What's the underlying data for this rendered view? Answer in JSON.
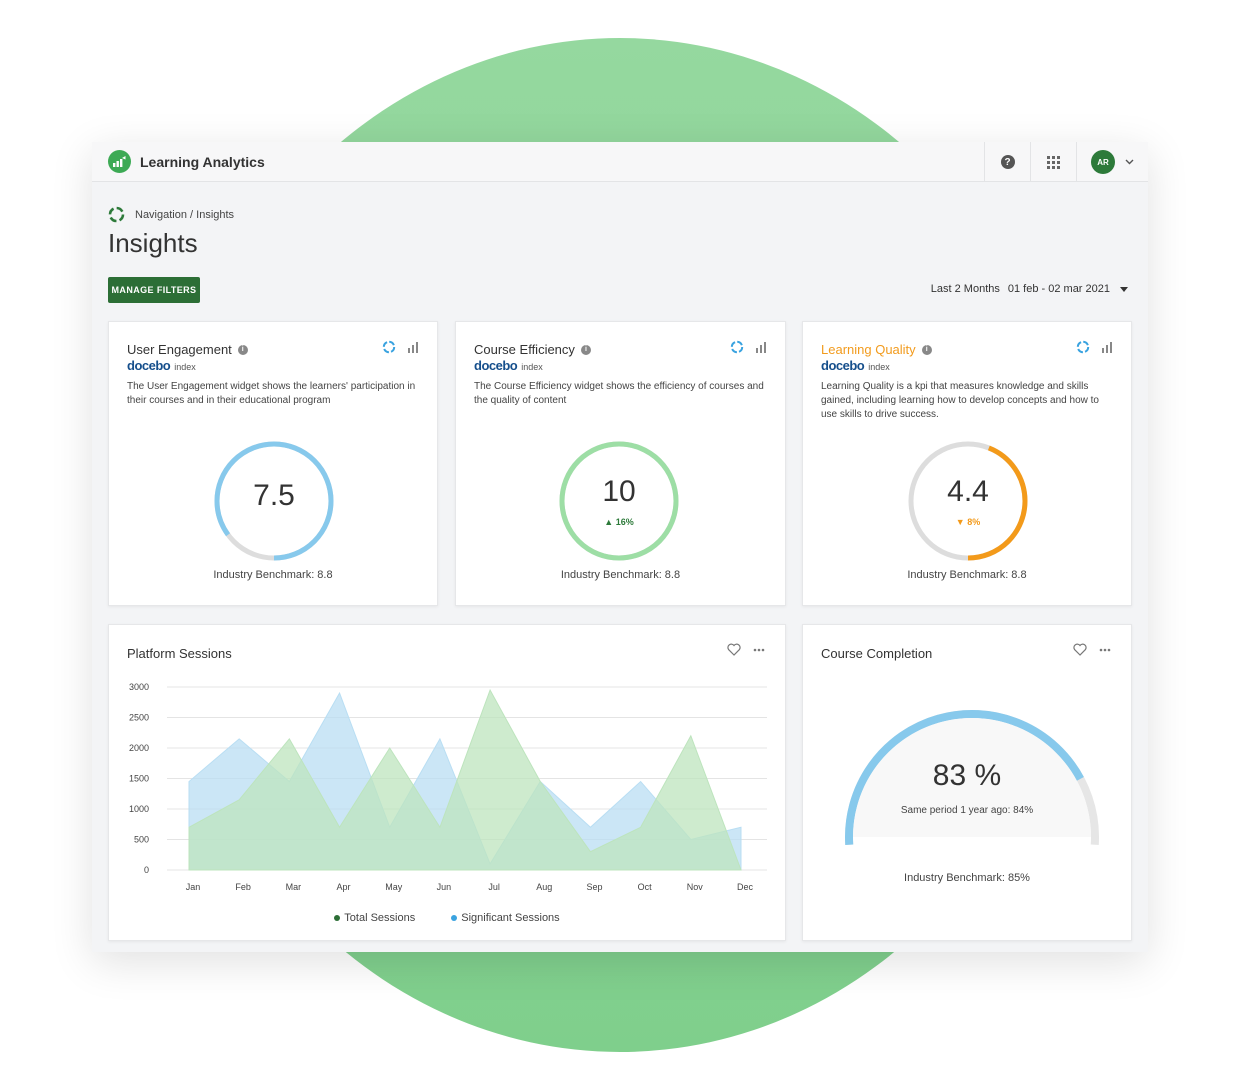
{
  "app": {
    "title": "Learning Analytics",
    "user_initials": "AR"
  },
  "breadcrumb": "Navigation / Insights",
  "page_title": "Insights",
  "filters": {
    "button_label": "MANAGE FILTERS",
    "range_label": "Last 2 Months",
    "range_value": "01 feb - 02 mar 2021"
  },
  "brand": {
    "name": "docebo",
    "suffix": "index"
  },
  "kpis": [
    {
      "title": "User Engagement",
      "description": "The User Engagement widget shows the learners' participation in their courses and in their educational program",
      "value": "7.5",
      "fraction": 0.85,
      "color": "#87c9ec",
      "delta": "",
      "benchmark": "Industry Benchmark: 8.8"
    },
    {
      "title": "Course Efficiency",
      "description": "The Course Efficiency widget shows the efficiency of courses and the quality of content",
      "value": "10",
      "fraction": 1.0,
      "color": "#9ddea5",
      "delta": "16%",
      "delta_color": "#2d7a3a",
      "benchmark": "Industry Benchmark: 8.8"
    },
    {
      "title": "Learning Quality",
      "title_color": "#f29b1d",
      "description": "Learning Quality is a kpi that measures knowledge and skills gained, including learning how to develop concepts and how to use skills to drive success.",
      "value": "4.4",
      "fraction": 0.44,
      "color": "#f39a1a",
      "delta": "8%",
      "delta_color": "#f39a1a",
      "benchmark": "Industry Benchmark: 8.8"
    }
  ],
  "sessions": {
    "title": "Platform Sessions",
    "legend": [
      {
        "label": "Total Sessions",
        "color": "#2c6e36"
      },
      {
        "label": "Significant Sessions",
        "color": "#3aa3e0"
      }
    ]
  },
  "completion": {
    "title": "Course Completion",
    "value": "83 %",
    "fraction": 0.83,
    "subtext": "Same period 1 year ago: 84%",
    "benchmark": "Industry Benchmark: 85%"
  },
  "chart_data": {
    "type": "area",
    "title": "Platform Sessions",
    "categories": [
      "Jan",
      "Feb",
      "Mar",
      "Apr",
      "May",
      "Jun",
      "Jul",
      "Aug",
      "Sep",
      "Oct",
      "Nov",
      "Dec"
    ],
    "ylim": [
      0,
      3000
    ],
    "yticks": [
      0,
      500,
      1000,
      1500,
      2000,
      2500,
      3000
    ],
    "grid": true,
    "legend_position": "bottom",
    "series": [
      {
        "name": "Significant Sessions",
        "color": "#b9def3",
        "values": [
          1450,
          2150,
          1450,
          2900,
          700,
          2150,
          100,
          1450,
          700,
          1450,
          500,
          700
        ]
      },
      {
        "name": "Total Sessions",
        "color": "#bde4bd",
        "values": [
          700,
          1150,
          2150,
          700,
          2000,
          700,
          2950,
          1450,
          300,
          700,
          2200,
          0
        ]
      }
    ]
  }
}
